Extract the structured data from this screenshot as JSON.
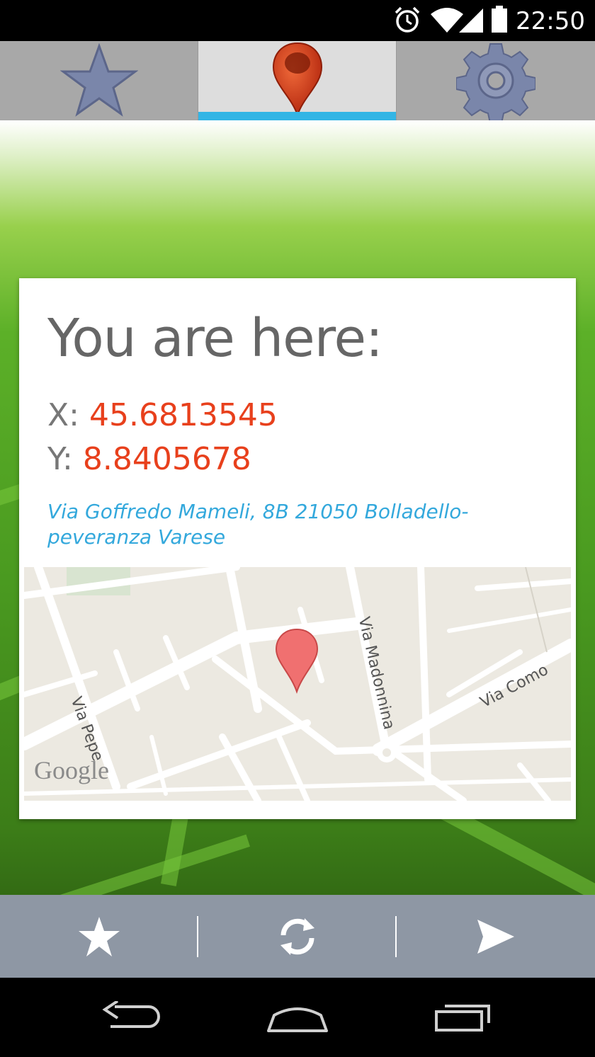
{
  "status_bar": {
    "time": "22:50",
    "icons": [
      "alarm-icon",
      "wifi-icon",
      "signal-icon",
      "battery-icon"
    ]
  },
  "tabs": [
    {
      "name": "favorites",
      "icon": "star-icon",
      "active": false
    },
    {
      "name": "location",
      "icon": "map-pin-icon",
      "active": true
    },
    {
      "name": "settings",
      "icon": "gear-icon",
      "active": false
    }
  ],
  "location_card": {
    "title": "You are here:",
    "x_label": "X:",
    "x_value": "45.6813545",
    "y_label": "Y:",
    "y_value": "8.8405678",
    "address": "Via Goffredo Mameli, 8B 21050 Bolladello-peveranza Varese"
  },
  "map": {
    "streets": [
      "Via Pepe",
      "Via Madonnina",
      "Via Como"
    ],
    "attribution": "Google"
  },
  "action_bar": {
    "icons": [
      "star-icon",
      "refresh-icon",
      "send-icon"
    ]
  },
  "nav_bar": {
    "icons": [
      "back-icon",
      "home-icon",
      "recents-icon"
    ]
  },
  "colors": {
    "accent": "#33b5e5",
    "coordinate_value": "#e8401c",
    "address_link": "#33a8dc",
    "action_bar": "#8e97a4"
  }
}
